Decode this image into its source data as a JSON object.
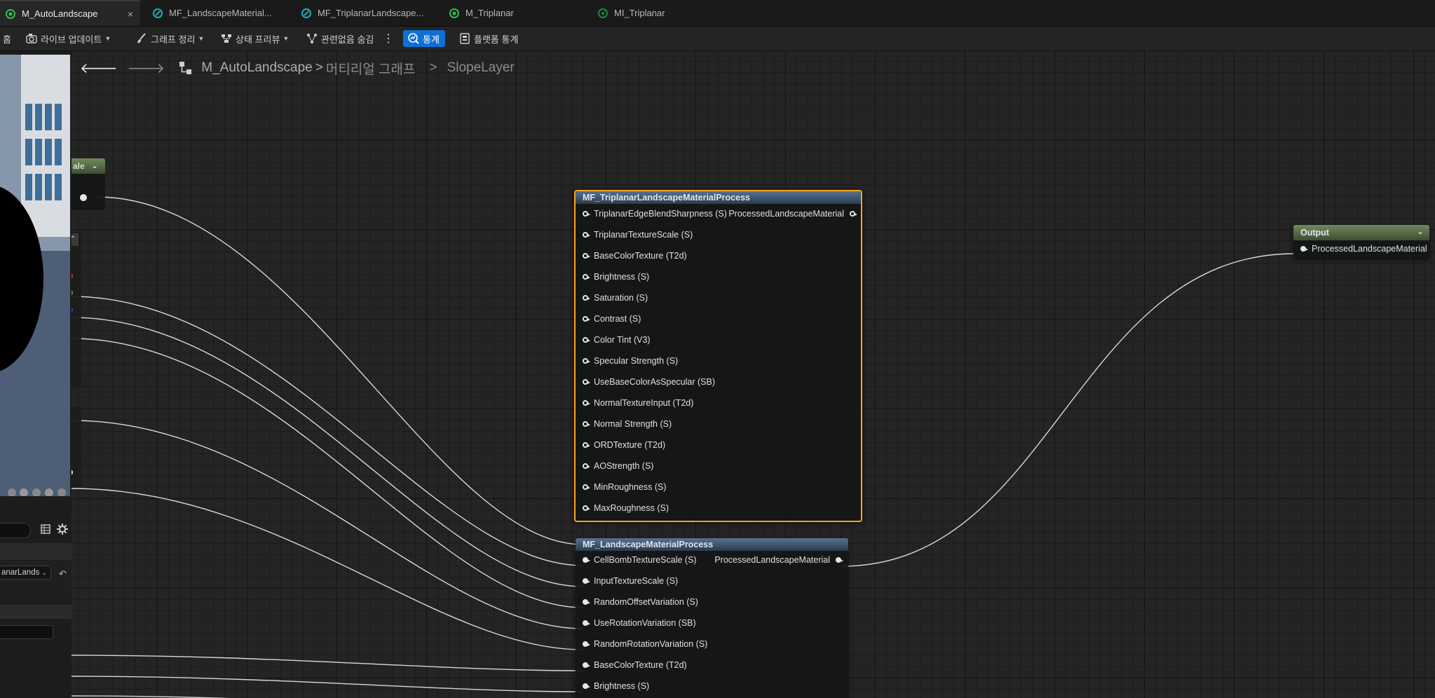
{
  "tabs": [
    {
      "label": "M_AutoLandscape",
      "icon": "material-icon",
      "active": true,
      "close": "×"
    },
    {
      "label": "MF_LandscapeMaterial...",
      "icon": "material-function-icon"
    },
    {
      "label": "MF_TriplanarLandscape...",
      "icon": "material-function-icon"
    },
    {
      "label": "M_Triplanar",
      "icon": "material-icon"
    },
    {
      "label": "MI_Triplanar",
      "icon": "material-instance-icon"
    }
  ],
  "toolbar": {
    "home_partial": "홈",
    "live_update": "라이브 업데이트",
    "clean_graph": "그래프 정리",
    "state_preview": "상태 프리뷰",
    "hide_unrelated": "관련없음 숨김",
    "stats": "통계",
    "platform_stats": "플랫폼 통계",
    "colors": {
      "active_button": "#0e6fd6"
    }
  },
  "left_panel": {
    "node_partial_title": "ale",
    "dropdown_partial": "anarLands"
  },
  "breadcrumb": {
    "root": "M_AutoLandscape",
    "sep1": ">",
    "level2": "머티리얼 그래프",
    "sep2": ">",
    "current": "SlopeLayer"
  },
  "nodes": {
    "triplanar": {
      "title": "MF_TriplanarLandscapeMaterialProcess",
      "output": "ProcessedLandscapeMaterial",
      "inputs": [
        "TriplanarEdgeBlendSharpness (S)",
        "TriplanarTextureScale (S)",
        "BaseColorTexture (T2d)",
        "Brightness (S)",
        "Saturation (S)",
        "Contrast (S)",
        "Color Tint (V3)",
        "Specular Strength (S)",
        "UseBaseColorAsSpecular (SB)",
        "NormalTextureInput (T2d)",
        "Normal Strength (S)",
        "ORDTexture (T2d)",
        "AOStrength (S)",
        "MinRoughness (S)",
        "MaxRoughness (S)"
      ],
      "selected_color": "#f5a623"
    },
    "landscape": {
      "title": "MF_LandscapeMaterialProcess",
      "output": "ProcessedLandscapeMaterial",
      "inputs": [
        "CellBombTextureScale (S)",
        "InputTextureScale (S)",
        "RandomOffsetVariation (S)",
        "UseRotationVariation (SB)",
        "RandomRotationVariation (S)",
        "BaseColorTexture (T2d)",
        "Brightness (S)"
      ]
    },
    "output": {
      "title": "Output",
      "pin": "ProcessedLandscapeMaterial"
    }
  }
}
